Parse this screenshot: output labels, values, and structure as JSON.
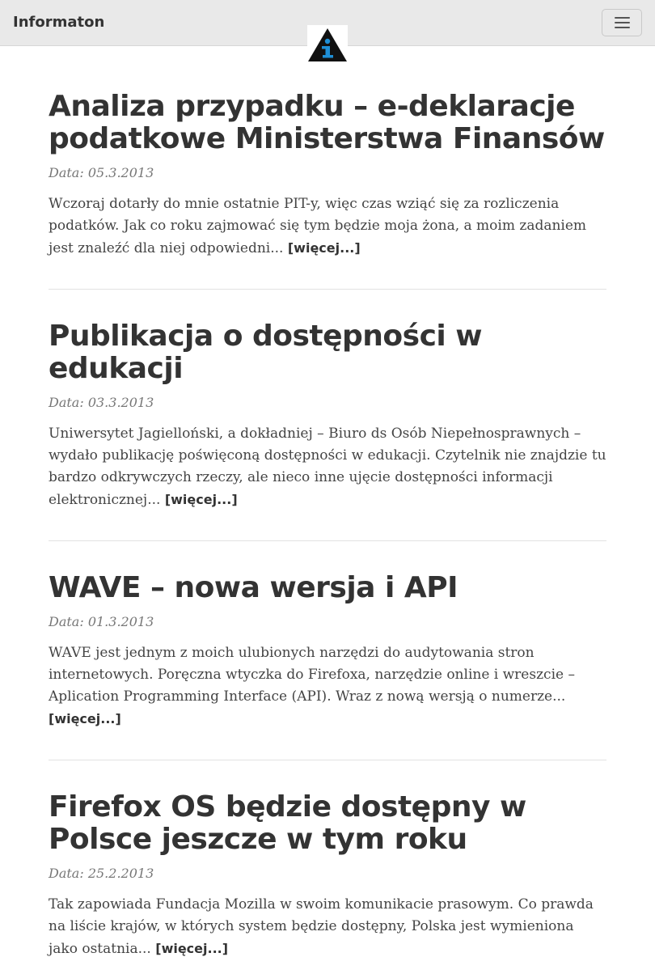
{
  "navbar": {
    "brand": "Informaton",
    "toggle_icon": "hamburger-icon",
    "logo_icon": "info-triangle-icon"
  },
  "posts": [
    {
      "title": "Analiza przypadku – e-deklaracje podatkowe Ministerstwa Finansów",
      "date": "Data: 05.3.2013",
      "excerpt": "Wczoraj dotarły do mnie ostatnie PIT-y, więc czas wziąć się za rozliczenia podatków. Jak co roku zajmować się tym będzie moja żona, a moim zadaniem jest znaleźć dla niej odpowiedni...",
      "more": "[więcej...]"
    },
    {
      "title": "Publikacja o dostępności w edukacji",
      "date": "Data: 03.3.2013",
      "excerpt": "Uniwersytet Jagielloński, a dokładniej – Biuro ds Osób Niepełnosprawnych – wydało publikację poświęconą dostępności w edukacji. Czytelnik nie znajdzie tu bardzo odkrywczych rzeczy, ale nieco inne ujęcie dostępności informacji elektronicznej...",
      "more": "[więcej...]"
    },
    {
      "title": "WAVE – nowa wersja i API",
      "date": "Data: 01.3.2013",
      "excerpt": "WAVE jest jednym z moich ulubionych narzędzi do audytowania stron internetowych. Poręczna wtyczka do Firefoxa, narzędzie online i wreszcie – Aplication Programming Interface (API). Wraz z nową wersją o numerze...",
      "more": "[więcej...]"
    },
    {
      "title": "Firefox OS będzie dostępny w Polsce jeszcze w tym roku",
      "date": "Data: 25.2.2013",
      "excerpt": "Tak zapowiada Fundacja Mozilla w swoim komunikacie prasowym. Co prawda na liście krajów, w których system będzie dostępny, Polska jest wymieniona jako ostatnia...",
      "more": "[więcej...]"
    }
  ],
  "colors": {
    "navbar_bg": "#e9e9e9",
    "text": "#333333",
    "date": "#777777",
    "logo_triangle": "#111111",
    "logo_i": "#1e8fd6"
  }
}
